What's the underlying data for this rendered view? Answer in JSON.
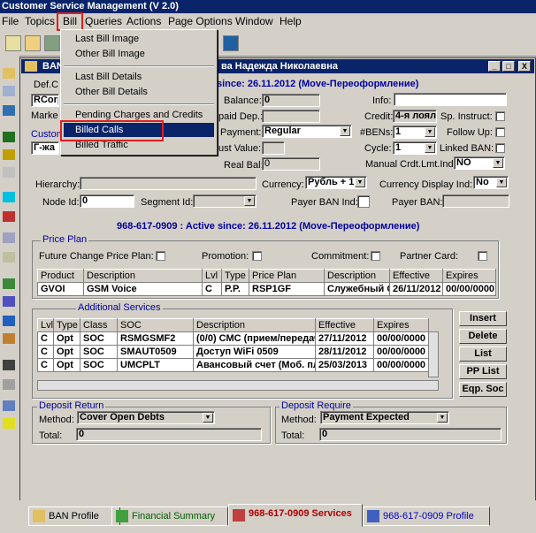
{
  "app_title": "Customer Service Management  (V 2.0)",
  "menu": [
    "File",
    "Topics",
    "Bill",
    "Queries",
    "Actions",
    "Page Options",
    "Window",
    "Help"
  ],
  "bill_menu": {
    "items": [
      "Last Bill Image",
      "Other Bill Image",
      "Last Bill Details",
      "Other Bill Details",
      "Pending Charges and Credits",
      "Billed Calls",
      "Billed Traffic"
    ],
    "selected": "Billed Calls"
  },
  "window": {
    "title_left": "BAN",
    "title_right": "ва Надежда Николаевна",
    "buttons": [
      "_",
      "□",
      "X"
    ]
  },
  "ban_header": {
    "status_text": "since: 26.11.2012 (Move-Переоформление)",
    "def_label": "Def.C",
    "rcorp_value": "RCorp",
    "market_label": "Marke",
    "custom_label": "Custom",
    "custom_value": "Г-жа",
    "balance_label": "Balance:",
    "balance_value": "0",
    "paid_dep_label": "paid Dep.:",
    "payment_label": "Payment:",
    "payment_value": "Regular",
    "cust_value_label": "ust Value:",
    "real_bal_label": "Real Bal:",
    "real_bal_value": "0",
    "info_label": "Info:",
    "credit_label": "Credit:",
    "credit_value": "4-я лоял",
    "sp_instruct_label": "Sp. Instruct:",
    "bens_label": "#BENs:",
    "bens_value": "1",
    "follow_up_label": "Follow Up:",
    "cycle_label": "Cycle:",
    "cycle_value": "1",
    "linked_ban_label": "Linked BAN:",
    "manual_label": "Manual Crdt.Lmt.Ind:",
    "manual_value": "NO",
    "hierarchy_label": "Hierarchy:",
    "currency_label": "Currency:",
    "currency_value": "Рубль + 1",
    "currency_disp_label": "Currency Display Ind:",
    "currency_disp_value": "No",
    "node_id_label": "Node Id:",
    "node_id_value": "0",
    "segment_id_label": "Segment Id:",
    "payer_ban_ind_label": "Payer BAN Ind:",
    "payer_ban_label": "Payer BAN:"
  },
  "subscriber_status": "968-617-0909 : Active since: 26.11.2012 (Move-Переоформление)",
  "price_plan": {
    "group_label": "Price Plan",
    "future_change_label": "Future Change Price Plan:",
    "promotion_label": "Promotion:",
    "commitment_label": "Commitment:",
    "partner_card_label": "Partner Card:",
    "columns": [
      "Product",
      "Description",
      "Lvl",
      "Type",
      "Price Plan",
      "Description",
      "Effective",
      "Expires"
    ],
    "row": [
      "GVOI",
      "GSM Voice",
      "C",
      "P.P.",
      "RSP1GF",
      "Служебный GSM",
      "26/11/2012",
      "00/00/0000"
    ]
  },
  "additional_services": {
    "group_label": "Additional Services",
    "columns": [
      "Lvl",
      "Type",
      "Class",
      "SOC",
      "Description",
      "Effective",
      "Expires"
    ],
    "rows": [
      [
        "C",
        "Opt",
        "SOC",
        "RSMGSMF2",
        "(0/0) СМС (прием/передача)",
        "27/11/2012",
        "00/00/0000"
      ],
      [
        "C",
        "Opt",
        "SOC",
        "SMAUT0509",
        "Доступ WiFi 0509",
        "28/11/2012",
        "00/00/0000"
      ],
      [
        "C",
        "Opt",
        "SOC",
        "UMCPLT",
        "Авансовый счет (Моб. платежи)",
        "25/03/2013",
        "00/00/0000"
      ]
    ],
    "buttons": [
      "Insert",
      "Delete",
      "List",
      "PP List",
      "Eqp. Soc"
    ]
  },
  "deposit_return": {
    "group_label": "Deposit Return",
    "method_label": "Method:",
    "method_value": "Cover Open Debts",
    "total_label": "Total:",
    "total_value": "0"
  },
  "deposit_require": {
    "group_label": "Deposit Require",
    "method_label": "Method:",
    "method_value": "Payment Expected",
    "total_label": "Total:",
    "total_value": "0"
  },
  "tabs": [
    "BAN Profile",
    "Financial Summary",
    "968-617-0909 Services",
    "968-617-0909 Profile"
  ],
  "active_tab": "968-617-0909 Services",
  "colors": {
    "titlebar": "#0a246a",
    "highlight_red": "#e02020",
    "banner_blue": "#0000a0"
  }
}
